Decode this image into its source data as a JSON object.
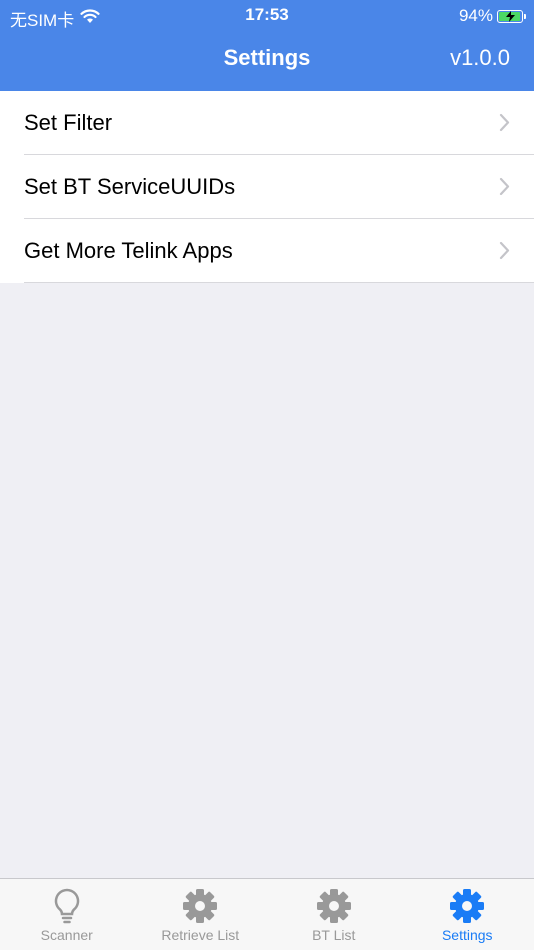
{
  "status_bar": {
    "carrier": "无SIM卡",
    "time": "17:53",
    "battery_percent": "94%",
    "battery_level": 0.94
  },
  "nav": {
    "title": "Settings",
    "version": "v1.0.0"
  },
  "settings": {
    "items": [
      {
        "label": "Set Filter"
      },
      {
        "label": "Set BT ServiceUUIDs"
      },
      {
        "label": "Get More Telink Apps"
      }
    ]
  },
  "tabbar": {
    "tabs": [
      {
        "label": "Scanner",
        "icon": "lightbulb-icon"
      },
      {
        "label": "Retrieve List",
        "icon": "gear-icon"
      },
      {
        "label": "BT List",
        "icon": "gear-icon"
      },
      {
        "label": "Settings",
        "icon": "gear-icon",
        "active": true
      }
    ],
    "active_color": "#1a7cf6",
    "inactive_color": "#999999"
  },
  "colors": {
    "header": "#4a86e8",
    "background": "#efeff4"
  }
}
